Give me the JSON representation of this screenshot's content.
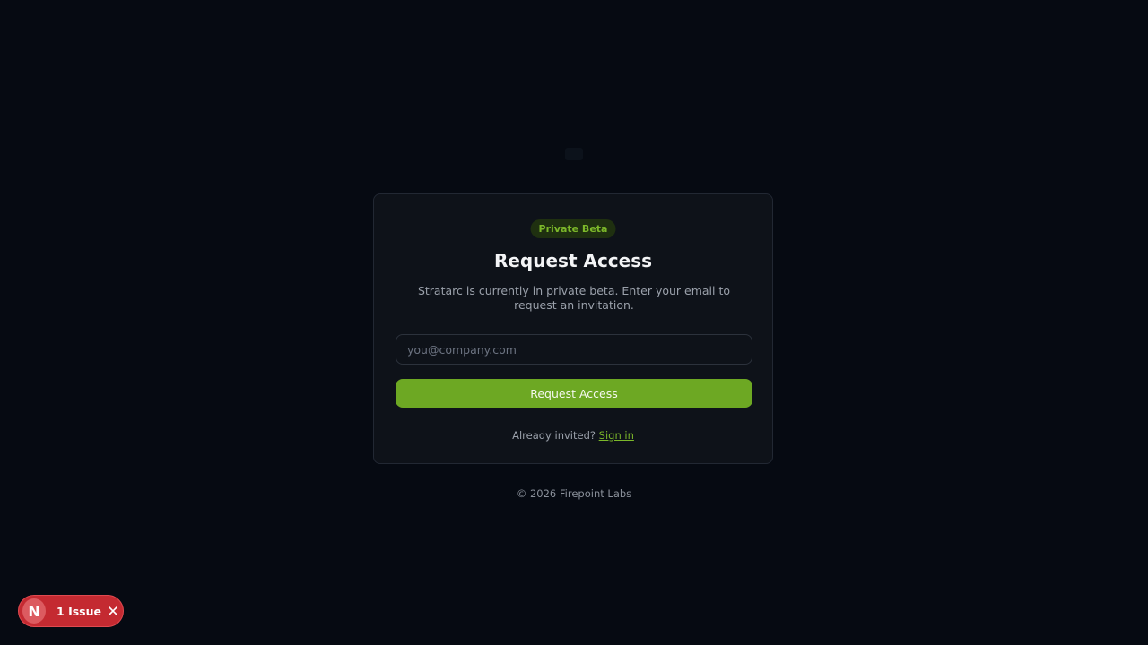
{
  "badge": "Private Beta",
  "title": "Request Access",
  "subtitle": "Stratarc is currently in private beta. Enter your email to request an invitation.",
  "form": {
    "email_placeholder": "you@company.com",
    "email_value": "",
    "submit_label": "Request Access"
  },
  "signin": {
    "prompt": "Already invited?",
    "link_label": "Sign in"
  },
  "footer": "© 2026 Firepoint Labs",
  "dev_overlay": {
    "logo_letter": "N",
    "issues_label": "1 Issue",
    "close_icon": "close-icon",
    "color": "#c42a31"
  },
  "colors": {
    "accent": "#6da823",
    "background": "#060a12",
    "card": "#0e1219"
  }
}
